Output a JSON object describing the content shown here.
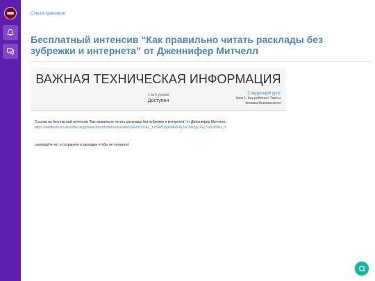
{
  "sidebar": {
    "logo": "school-logo",
    "items": [
      {
        "icon": "bell-icon"
      },
      {
        "icon": "chat-icon"
      }
    ]
  },
  "breadcrumb": {
    "label": "Список тренингов"
  },
  "page": {
    "title": "Бесплатный интенсив “Как правильно читать расклады без зубрежки и интернета” от Дженнифер Митчелл"
  },
  "lesson": {
    "heading": "ВАЖНАЯ ТЕХНИЧЕСКАЯ ИНФОРМАЦИЯ",
    "count": "1 из 5 уроков",
    "status": "Доступен",
    "next_label": "Следующий урок",
    "next_title": "Урок 1. Как работает Таро и техника безопасности"
  },
  "content": {
    "intro": "Ссылка на бесплатный интенсив “Как правильно читать расклады без зубрежки и интернета” от Дженнифер Митчелл:",
    "link": "https://webinars-os.neocities.org/pl/teach/control/lesson/view%3Fid=0324L_Xz5RW3q9oMEb-Pj2aChtKfyyUGy7vd1/index_0",
    "note": "скопируйте её, и сохраните в закладки чтобы не потерять!"
  },
  "colors": {
    "sidebar": "#5f1fae",
    "accent": "#3a82c4",
    "title": "#4a86c0",
    "chat": "#17b3a6"
  },
  "chat": {
    "icon": "chat-bubble-icon"
  }
}
